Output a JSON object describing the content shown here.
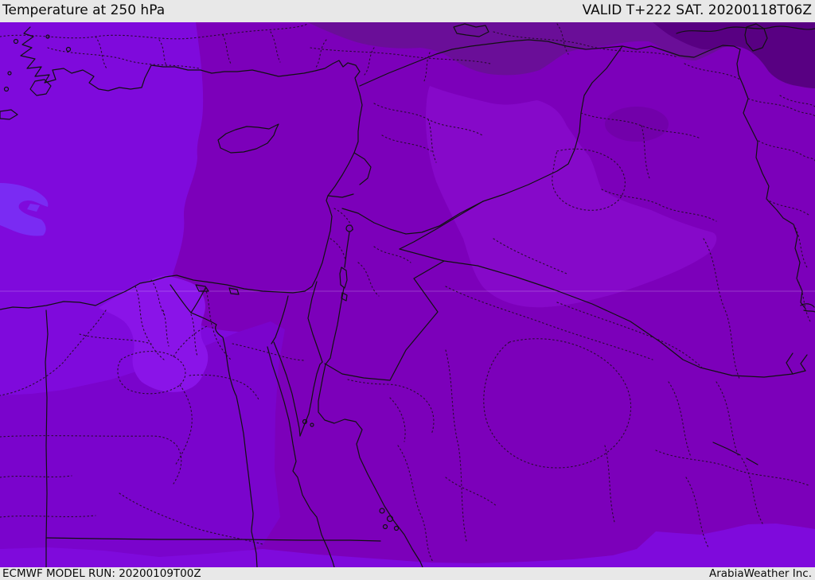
{
  "header": {
    "title": "Temperature at 250 hPa",
    "validity": "VALID T+222 SAT. 20200118T06Z"
  },
  "footer": {
    "model_run": "ECMWF MODEL RUN: 20200109T00Z",
    "brand": "ArabiaWeather Inc."
  },
  "map": {
    "colors": {
      "bar_bg": "#e8e8e8",
      "base": "#7c00ba",
      "mid_light": "#8609c9",
      "south_egypt": "#7a04cc",
      "west_bright": "#7f0adc",
      "delta_patch": "#8a14e8",
      "cold_blob": "#7a2bf3",
      "dark_band": "#6a0e98",
      "darkest": "#580082",
      "border": "#111111",
      "admin": "#2a0a33",
      "gridline": "rgba(255,255,255,0.22)"
    }
  }
}
